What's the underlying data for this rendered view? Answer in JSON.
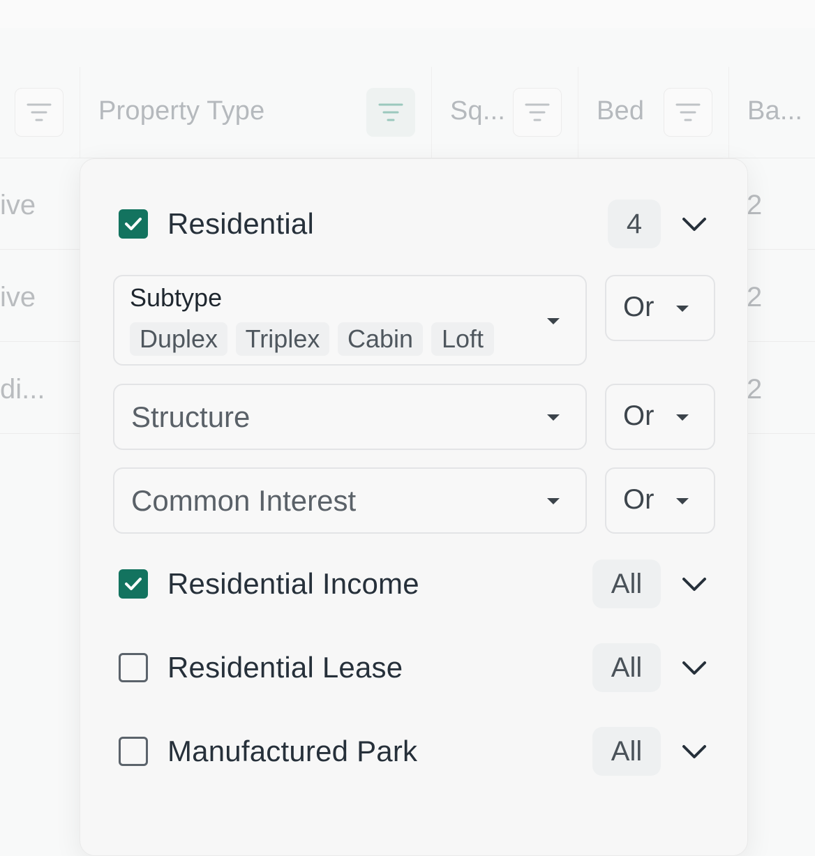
{
  "table": {
    "columns": [
      {
        "title": "Property Type"
      },
      {
        "title": "Sq..."
      },
      {
        "title": "Bed"
      },
      {
        "title": "Ba..."
      }
    ],
    "left_cells": [
      "ive",
      "ive",
      "di..."
    ],
    "right_cells": [
      "2",
      "2",
      "2"
    ]
  },
  "panel": {
    "residential": {
      "label": "Residential",
      "count": "4",
      "checked": true
    },
    "subtype": {
      "label": "Subtype",
      "chips": [
        "Duplex",
        "Triplex",
        "Cabin",
        "Loft"
      ],
      "operator": "Or"
    },
    "structure": {
      "label": "Structure",
      "operator": "Or"
    },
    "common_interest": {
      "label": "Common Interest",
      "operator": "Or"
    },
    "groups": [
      {
        "label": "Residential Income",
        "badge": "All",
        "checked": true
      },
      {
        "label": "Residential Lease",
        "badge": "All",
        "checked": false
      },
      {
        "label": "Manufactured Park",
        "badge": "All",
        "checked": false
      }
    ]
  },
  "colors": {
    "accent": "#13735f",
    "text": "#26303a",
    "muted": "#b5b9bd"
  },
  "icons": {
    "filter": "filter-lines-icon",
    "check": "check-icon",
    "chevron": "chevron-down-icon",
    "caret": "caret-down-icon"
  }
}
